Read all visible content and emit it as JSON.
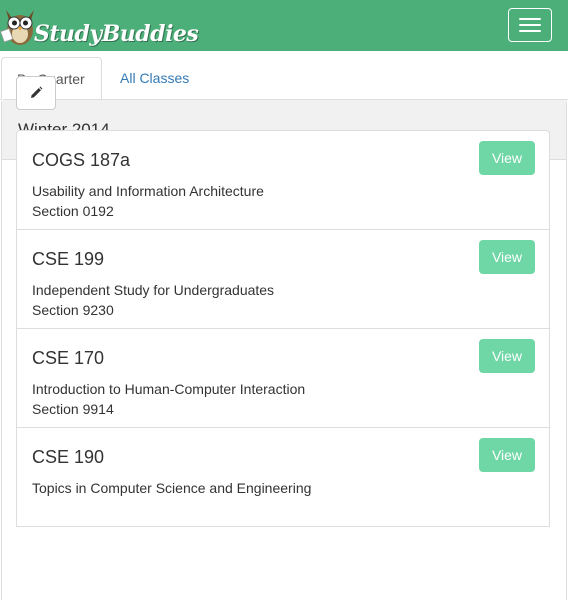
{
  "navbar": {
    "brand": "StudyBuddies",
    "logo_icon": "owl-icon",
    "menu_icon": "hamburger-icon",
    "color": "#4caf7a"
  },
  "tabs": [
    {
      "label": "By Quarter",
      "active": true
    },
    {
      "label": "All Classes",
      "active": false
    }
  ],
  "quarter": {
    "title": "Winter 2014",
    "edit_icon": "pencil-icon"
  },
  "classes": [
    {
      "code": "COGS 187a",
      "title": "Usability and Information Architecture",
      "section": "Section 0192",
      "button": "View"
    },
    {
      "code": "CSE 199",
      "title": "Independent Study for Undergraduates",
      "section": "Section 9230",
      "button": "View"
    },
    {
      "code": "CSE 170",
      "title": "Introduction to Human-Computer Interaction",
      "section": "Section 9914",
      "button": "View"
    },
    {
      "code": "CSE 190",
      "title": "Topics in Computer Science and Engineering",
      "section": "",
      "button": "View"
    }
  ],
  "colors": {
    "view_button": "#6fd6a6",
    "link": "#337ab7"
  }
}
